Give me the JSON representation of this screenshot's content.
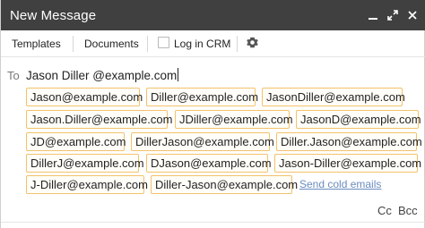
{
  "window": {
    "title": "New Message"
  },
  "toolbar": {
    "templates": "Templates",
    "documents": "Documents",
    "log_in_crm": "Log in CRM"
  },
  "to": {
    "label": "To",
    "value": "Jason Diller @example.com"
  },
  "suggestions": [
    "Jason@example.com",
    "Diller@example.com",
    "JasonDiller@example.com",
    "Jason.Diller@example.com",
    "JDiller@example.com",
    "JasonD@example.com",
    "JD@example.com",
    "DillerJason@example.com",
    "Diller.Jason@example.com",
    "DillerJ@example.com",
    "DJason@example.com",
    "Jason-Diller@example.com",
    "J-Diller@example.com",
    "Diller-Jason@example.com"
  ],
  "send_cold_emails": "Send cold emails",
  "cc": "Cc",
  "bcc": "Bcc",
  "colors": {
    "titlebar": "#404040",
    "chip_border": "#f3c26b",
    "link": "#6a8cbf"
  }
}
